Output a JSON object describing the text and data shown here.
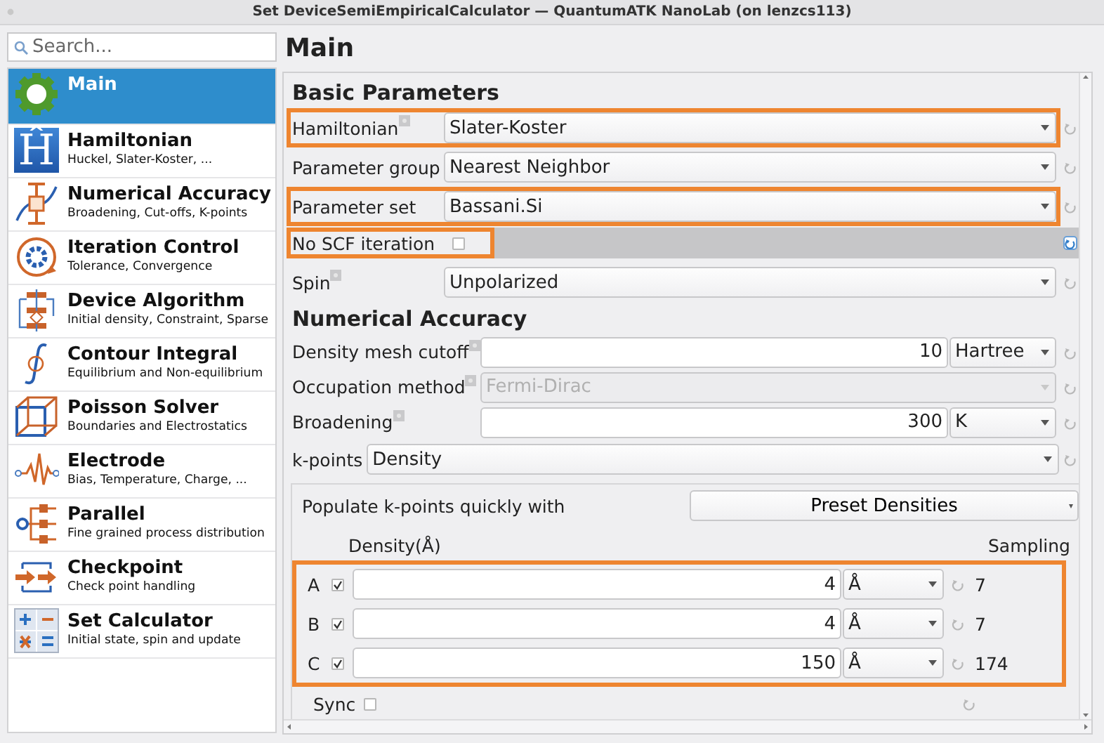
{
  "window": {
    "title": "Set DeviceSemiEmpiricalCalculator — QuantumATK NanoLab (on lenzcs113)"
  },
  "sidebar": {
    "search": {
      "placeholder": "Search..."
    },
    "items": [
      {
        "title": "Main",
        "selected": true
      },
      {
        "title": "Hamiltonian",
        "subtitle": "Huckel, Slater-Koster, ...",
        "selected": false,
        "icon_text": "Ĥ"
      },
      {
        "title": "Numerical Accuracy",
        "subtitle": "Broadening, Cut-offs, K-points",
        "selected": false
      },
      {
        "title": "Iteration Control",
        "subtitle": "Tolerance, Convergence",
        "selected": false
      },
      {
        "title": "Device Algorithm",
        "subtitle": "Initial density, Constraint, Sparse",
        "selected": false
      },
      {
        "title": "Contour Integral",
        "subtitle": "Equilibrium and Non-equilibrium",
        "selected": false
      },
      {
        "title": "Poisson Solver",
        "subtitle": "Boundaries and Electrostatics",
        "selected": false
      },
      {
        "title": "Electrode",
        "subtitle": "Bias, Temperature, Charge, ...",
        "selected": false
      },
      {
        "title": "Parallel",
        "subtitle": "Fine grained process distribution",
        "selected": false
      },
      {
        "title": "Checkpoint",
        "subtitle": "Check point handling",
        "selected": false
      },
      {
        "title": "Set Calculator",
        "subtitle": "Initial state, spin  and update",
        "selected": false
      }
    ]
  },
  "page_title": "Main",
  "sections": [
    {
      "title": "Basic Parameters",
      "rows": [
        {
          "kind": "combo",
          "label": "Hamiltonian",
          "value": "Slater-Koster",
          "help": true,
          "highlighted": true,
          "disabled": false
        },
        {
          "kind": "combo",
          "label": "Parameter group",
          "value": "Nearest Neighbor",
          "help": false,
          "highlighted": false,
          "disabled": false
        },
        {
          "kind": "combo",
          "label": "Parameter set",
          "value": "Bassani.Si",
          "help": false,
          "highlighted": true,
          "disabled": false
        },
        {
          "kind": "checkbox",
          "label": "No SCF iteration",
          "checked": false,
          "help": false,
          "highlighted": true
        },
        {
          "kind": "combo",
          "label": "Spin",
          "value": "Unpolarized",
          "help": true,
          "highlighted": false,
          "disabled": false
        }
      ]
    },
    {
      "title": "Numerical Accuracy",
      "rows": [
        {
          "kind": "quantity",
          "label": "Density mesh cutoff",
          "value": "10",
          "unit": "Hartree",
          "help": true,
          "highlighted": false
        },
        {
          "kind": "combo",
          "label": "Occupation method",
          "value": "Fermi-Dirac",
          "help": true,
          "highlighted": false,
          "disabled": true
        },
        {
          "kind": "quantity",
          "label": "Broadening",
          "value": "300",
          "unit": "K",
          "help": true,
          "highlighted": false
        }
      ],
      "kpoints": {
        "label": "k-points",
        "value": "Density",
        "populate_label": "Populate k-points quickly with",
        "preset_button": "Preset Densities",
        "density_header": "Density(Å)",
        "sampling_header": "Sampling",
        "highlighted": true,
        "axes": [
          {
            "name": "A",
            "checked": true,
            "value": "4",
            "unit": "Å",
            "sampling": "7"
          },
          {
            "name": "B",
            "checked": true,
            "value": "4",
            "unit": "Å",
            "sampling": "7"
          },
          {
            "name": "C",
            "checked": true,
            "value": "150",
            "unit": "Å",
            "sampling": "174"
          }
        ],
        "sync": {
          "label": "Sync",
          "checked": false
        }
      }
    }
  ]
}
